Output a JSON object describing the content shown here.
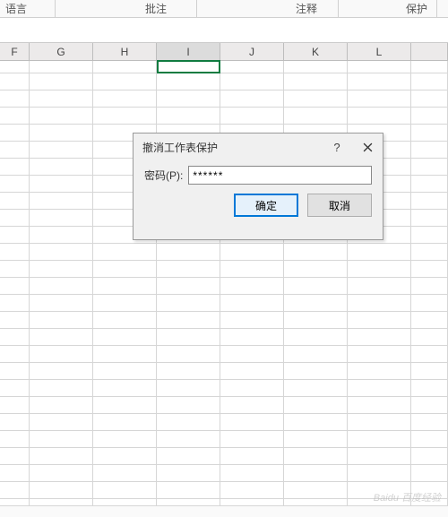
{
  "ribbon": {
    "tabs": [
      "语言",
      "批注",
      "注释",
      "保护"
    ]
  },
  "columns": [
    "F",
    "G",
    "H",
    "I",
    "J",
    "K",
    "L"
  ],
  "active_column_index": 3,
  "dialog": {
    "title": "撤消工作表保护",
    "help": "?",
    "password_label": "密码(P):",
    "password_value": "******",
    "ok": "确定",
    "cancel": "取消"
  },
  "watermark": "Baidu 百度经验"
}
